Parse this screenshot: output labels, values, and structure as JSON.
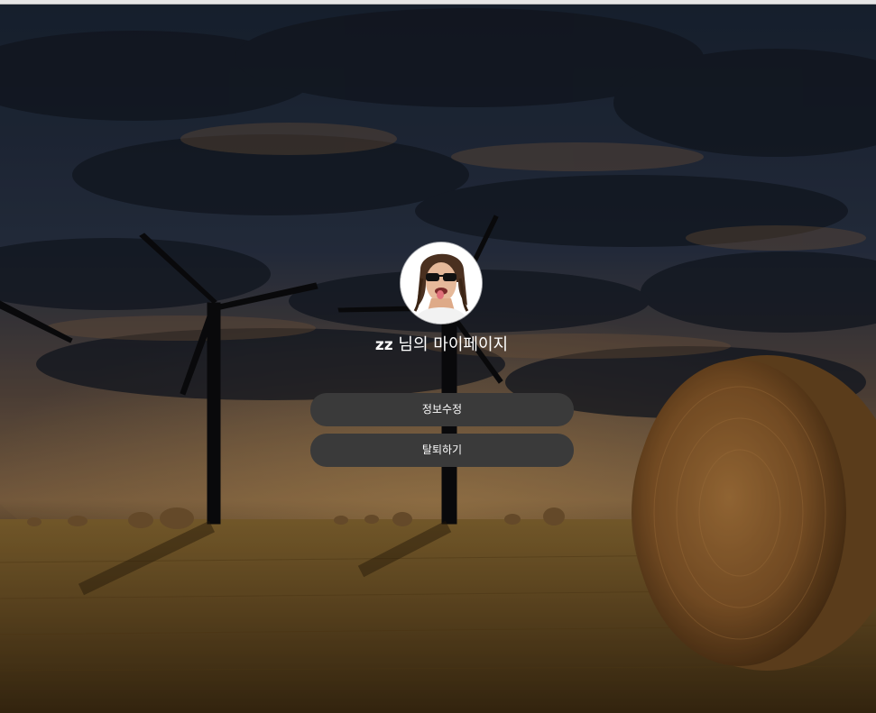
{
  "profile": {
    "nickname": "zz",
    "title_suffix": " 님의 마이페이지"
  },
  "actions": {
    "edit_label": "정보수정",
    "withdraw_label": "탈퇴하기"
  },
  "colors": {
    "button_bg": "#3a3a3a",
    "text": "#ffffff"
  }
}
